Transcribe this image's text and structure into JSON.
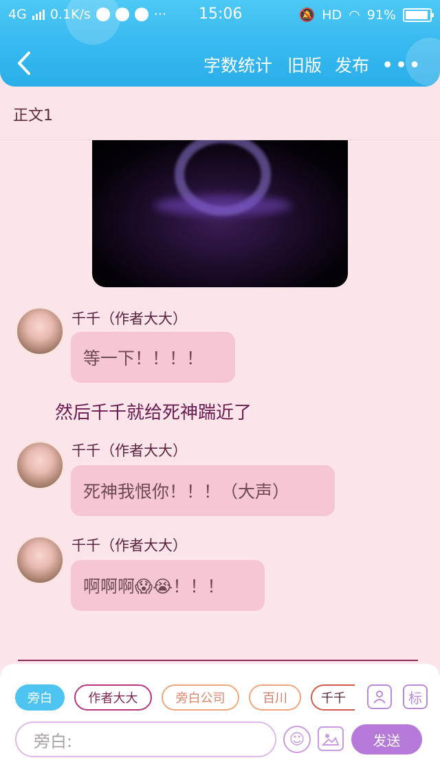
{
  "status_bar": {
    "network": "4G",
    "speed": "0.1K/s",
    "time": "15:06",
    "hd": "HD",
    "battery": "91%"
  },
  "header": {
    "back_icon": "chevron-left-icon",
    "word_count": "字数统计",
    "old_version": "旧版",
    "publish": "发布",
    "more_icon": "more-icon"
  },
  "document": {
    "subtitle": "正文1"
  },
  "messages": [
    {
      "name": "千千（作者大大）",
      "text": "等一下！！！！"
    },
    {
      "name": "千千（作者大大）",
      "text": "死神我恨你！！！（大声）"
    },
    {
      "name": "千千（作者大大）",
      "text": "啊啊啊😱😭！！！"
    }
  ],
  "narration": "然后千千就给死神踹近了",
  "composer": {
    "chips": [
      "旁白",
      "作者大大",
      "旁白公司",
      "百川",
      "千千"
    ],
    "chip_colors": {
      "active": "#4dc3ef",
      "purple": "#b7357a",
      "orange": "#f0a57b",
      "red": "#d2584a"
    },
    "input_placeholder": "旁白:",
    "send_label": "发送",
    "emoji_icon": "smile-icon",
    "image_icon": "image-icon",
    "role_icon": "person-icon",
    "tag_label": "标"
  }
}
